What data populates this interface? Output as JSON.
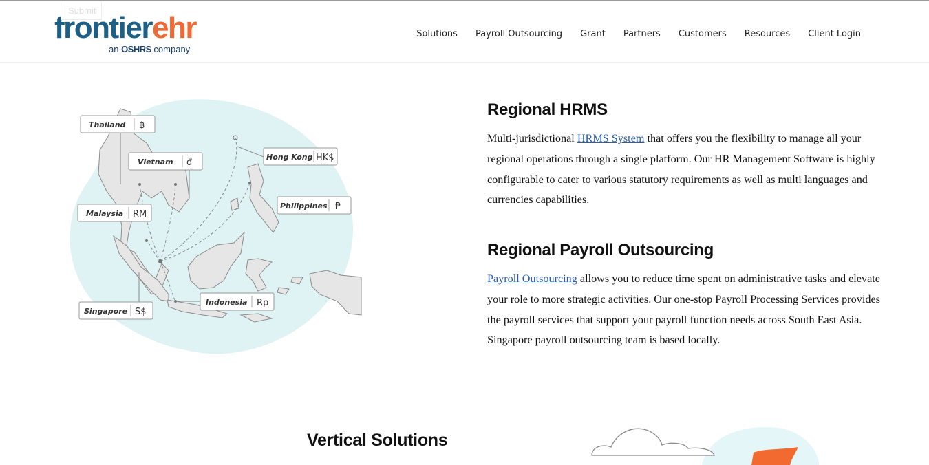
{
  "ghost_button": {
    "label": "Submit"
  },
  "brand": {
    "name_part1": "frontier",
    "name_part2": "ehr",
    "tagline_prefix": "an ",
    "tagline_brand": "OSHRS",
    "tagline_suffix": " company",
    "colors": {
      "primary": "#1c5f87",
      "accent": "#ef6a37",
      "dark": "#1c3f66"
    }
  },
  "nav": {
    "items": [
      "Solutions",
      "Payroll Outsourcing",
      "Grant",
      "Partners",
      "Customers",
      "Resources",
      "Client Login"
    ]
  },
  "map": {
    "countries": [
      {
        "name": "Thailand",
        "currency": "฿"
      },
      {
        "name": "Vietnam",
        "currency": "₫"
      },
      {
        "name": "Hong Kong",
        "currency": "HK$"
      },
      {
        "name": "Malaysia",
        "currency": "RM"
      },
      {
        "name": "Philippines",
        "currency": "₱"
      },
      {
        "name": "Singapore",
        "currency": "S$"
      },
      {
        "name": "Indonesia",
        "currency": "Rp"
      }
    ]
  },
  "sections": {
    "hrms": {
      "title": "Regional HRMS",
      "text_before_link": "Multi-jurisdictional ",
      "link": "HRMS System",
      "text_after_link": " that offers you the flexibility to manage all your regional operations through a single platform. Our HR Management Software is highly configurable to cater to various statutory requirements as well as multi languages and currencies capabilities."
    },
    "payroll": {
      "title": "Regional Payroll Outsourcing",
      "link": "Payroll Outsourcing",
      "text_after_link": " allows you to reduce time spent on administrative tasks and elevate your role to more strategic activities. Our one-stop Payroll Processing Services provides the payroll services that support your payroll function needs across South East Asia. Singapore payroll outsourcing team is based locally."
    }
  },
  "vertical": {
    "title": "Vertical Solutions"
  }
}
